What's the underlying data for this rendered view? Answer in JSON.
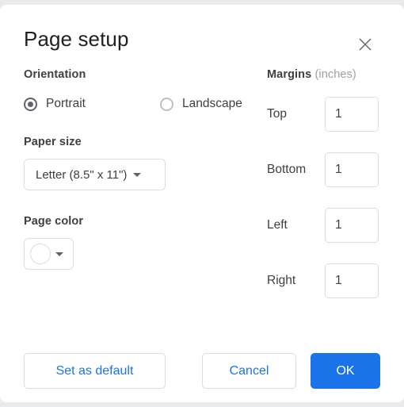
{
  "dialog": {
    "title": "Page setup",
    "close_icon": "close-icon"
  },
  "orientation": {
    "label": "Orientation",
    "options": [
      {
        "label": "Portrait",
        "selected": true
      },
      {
        "label": "Landscape",
        "selected": false
      }
    ]
  },
  "paper_size": {
    "label": "Paper size",
    "value": "Letter (8.5\" x 11\")",
    "caret_icon": "chevron-down-icon"
  },
  "page_color": {
    "label": "Page color",
    "swatch_color": "#ffffff",
    "caret_icon": "chevron-down-icon"
  },
  "margins": {
    "heading": "Margins",
    "unit": "(inches)",
    "fields": [
      {
        "label": "Top",
        "value": "1"
      },
      {
        "label": "Bottom",
        "value": "1"
      },
      {
        "label": "Left",
        "value": "1"
      },
      {
        "label": "Right",
        "value": "1"
      }
    ]
  },
  "footer": {
    "set_default_label": "Set as default",
    "cancel_label": "Cancel",
    "ok_label": "OK"
  },
  "colors": {
    "accent": "#1a73e8",
    "text": "#3c4043",
    "title": "#202124",
    "muted": "#9aa0a6",
    "border": "#dadce0",
    "radio_selected": "#5f6368"
  }
}
